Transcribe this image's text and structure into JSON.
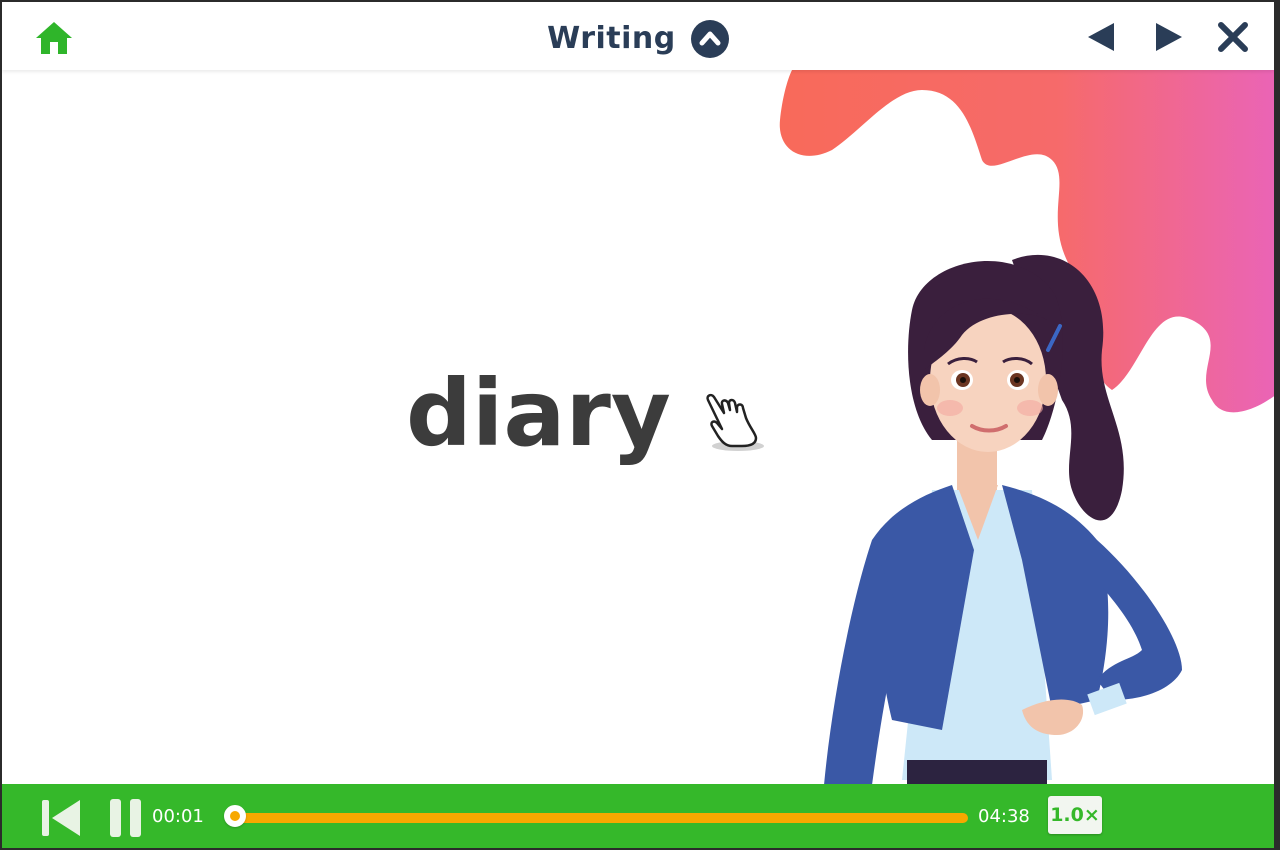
{
  "header": {
    "title": "Writing",
    "icons": {
      "home": "home-icon",
      "title_toggle": "chevron-up-icon",
      "prev": "triangle-left-icon",
      "next": "triangle-right-icon",
      "close": "close-icon"
    }
  },
  "content": {
    "word": "diary",
    "cursor_icon": "hand-pointer-icon",
    "illustration": "teacher-illustration"
  },
  "player": {
    "current_time": "00:01",
    "total_time": "04:38",
    "progress_fraction": 0.004,
    "speed_label": "1.0×",
    "icons": {
      "restart": "skip-back-icon",
      "pause": "pause-icon"
    }
  },
  "colors": {
    "player_bar": "#35b82a",
    "progress": "#f7a800",
    "title_text": "#2a3d57",
    "home_icon": "#2fb52a",
    "word_text": "#3c3c3c"
  }
}
